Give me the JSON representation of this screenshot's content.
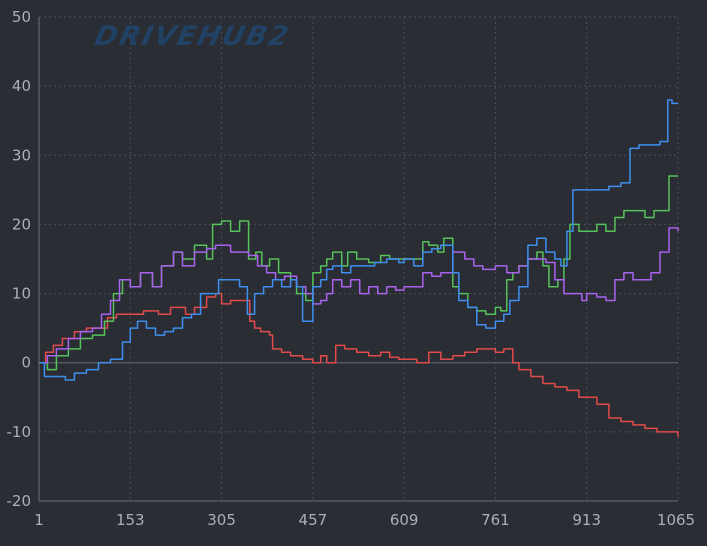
{
  "watermark_text": "DRIVEHUB2",
  "colors": {
    "background": "#2a2d33",
    "grid": "#4a4f57",
    "axis": "#6b717a",
    "zero_line": "#5a5f67",
    "text": "#a9b0bb"
  },
  "chart_data": {
    "type": "line",
    "title": "",
    "xlabel": "",
    "ylabel": "",
    "xlim": [
      1,
      1065
    ],
    "ylim": [
      -20,
      50
    ],
    "x_ticks": [
      1,
      153,
      305,
      457,
      609,
      761,
      913,
      1065
    ],
    "y_ticks": [
      -20,
      -10,
      0,
      10,
      20,
      30,
      40,
      50
    ],
    "grid": true,
    "legend": "none",
    "series": [
      {
        "color": "#e14b4b",
        "points": [
          [
            1,
            0
          ],
          [
            12,
            1.5
          ],
          [
            25,
            2.5
          ],
          [
            40,
            3.5
          ],
          [
            60,
            4.5
          ],
          [
            80,
            5
          ],
          [
            100,
            5
          ],
          [
            115,
            6.5
          ],
          [
            130,
            7
          ],
          [
            153,
            7
          ],
          [
            175,
            7.5
          ],
          [
            200,
            7
          ],
          [
            220,
            8
          ],
          [
            245,
            7
          ],
          [
            260,
            8
          ],
          [
            280,
            9.5
          ],
          [
            295,
            10
          ],
          [
            305,
            8.5
          ],
          [
            320,
            9
          ],
          [
            340,
            9
          ],
          [
            352,
            6
          ],
          [
            360,
            5
          ],
          [
            370,
            4.5
          ],
          [
            385,
            4
          ],
          [
            390,
            2
          ],
          [
            405,
            1.5
          ],
          [
            420,
            1
          ],
          [
            440,
            0.5
          ],
          [
            457,
            0
          ],
          [
            470,
            1
          ],
          [
            480,
            0
          ],
          [
            495,
            2.5
          ],
          [
            510,
            2
          ],
          [
            530,
            1.5
          ],
          [
            550,
            1
          ],
          [
            570,
            1.5
          ],
          [
            585,
            0.8
          ],
          [
            600,
            0.5
          ],
          [
            609,
            0.5
          ],
          [
            630,
            0
          ],
          [
            650,
            1.5
          ],
          [
            670,
            0.5
          ],
          [
            690,
            1
          ],
          [
            710,
            1.5
          ],
          [
            730,
            2
          ],
          [
            745,
            2
          ],
          [
            761,
            1.5
          ],
          [
            775,
            2
          ],
          [
            790,
            0
          ],
          [
            800,
            -1
          ],
          [
            820,
            -2
          ],
          [
            840,
            -3
          ],
          [
            860,
            -3.5
          ],
          [
            880,
            -4
          ],
          [
            900,
            -5
          ],
          [
            913,
            -5
          ],
          [
            930,
            -6
          ],
          [
            950,
            -8
          ],
          [
            970,
            -8.5
          ],
          [
            990,
            -9
          ],
          [
            1010,
            -9.5
          ],
          [
            1030,
            -10
          ],
          [
            1050,
            -10
          ],
          [
            1065,
            -10.7
          ]
        ]
      },
      {
        "color": "#56c25a",
        "points": [
          [
            1,
            0
          ],
          [
            15,
            -1
          ],
          [
            30,
            1
          ],
          [
            50,
            2
          ],
          [
            70,
            3.5
          ],
          [
            90,
            4
          ],
          [
            110,
            6
          ],
          [
            125,
            10
          ],
          [
            140,
            12
          ],
          [
            153,
            11
          ],
          [
            170,
            13
          ],
          [
            190,
            11
          ],
          [
            205,
            14
          ],
          [
            225,
            16
          ],
          [
            240,
            15
          ],
          [
            260,
            17
          ],
          [
            280,
            15
          ],
          [
            290,
            20
          ],
          [
            305,
            20.5
          ],
          [
            320,
            19
          ],
          [
            335,
            20.5
          ],
          [
            350,
            15
          ],
          [
            362,
            16
          ],
          [
            372,
            14
          ],
          [
            385,
            15
          ],
          [
            400,
            13
          ],
          [
            420,
            12
          ],
          [
            430,
            10
          ],
          [
            445,
            9
          ],
          [
            457,
            13
          ],
          [
            470,
            14
          ],
          [
            480,
            15
          ],
          [
            490,
            16
          ],
          [
            505,
            14
          ],
          [
            515,
            16
          ],
          [
            530,
            15
          ],
          [
            550,
            14.5
          ],
          [
            570,
            15.5
          ],
          [
            585,
            15
          ],
          [
            600,
            15
          ],
          [
            609,
            15
          ],
          [
            620,
            15
          ],
          [
            640,
            17.5
          ],
          [
            650,
            17
          ],
          [
            665,
            16
          ],
          [
            675,
            18
          ],
          [
            690,
            11
          ],
          [
            700,
            10
          ],
          [
            715,
            8
          ],
          [
            730,
            7.5
          ],
          [
            745,
            7
          ],
          [
            761,
            8
          ],
          [
            770,
            7.5
          ],
          [
            780,
            12
          ],
          [
            790,
            13
          ],
          [
            800,
            14
          ],
          [
            815,
            15
          ],
          [
            830,
            16
          ],
          [
            840,
            14
          ],
          [
            850,
            11
          ],
          [
            865,
            12
          ],
          [
            875,
            15
          ],
          [
            885,
            20
          ],
          [
            900,
            19
          ],
          [
            913,
            19
          ],
          [
            930,
            20
          ],
          [
            945,
            19
          ],
          [
            960,
            21
          ],
          [
            975,
            22
          ],
          [
            990,
            22
          ],
          [
            1010,
            21
          ],
          [
            1025,
            22
          ],
          [
            1040,
            22
          ],
          [
            1050,
            27
          ],
          [
            1065,
            27
          ]
        ]
      },
      {
        "color": "#a963f0",
        "points": [
          [
            1,
            0
          ],
          [
            15,
            1
          ],
          [
            30,
            2
          ],
          [
            50,
            3.5
          ],
          [
            70,
            4.5
          ],
          [
            90,
            5
          ],
          [
            105,
            7
          ],
          [
            120,
            9
          ],
          [
            135,
            12
          ],
          [
            153,
            11
          ],
          [
            170,
            13
          ],
          [
            190,
            11
          ],
          [
            205,
            14
          ],
          [
            225,
            16
          ],
          [
            240,
            14
          ],
          [
            260,
            16
          ],
          [
            280,
            16.5
          ],
          [
            295,
            17
          ],
          [
            305,
            17
          ],
          [
            320,
            16
          ],
          [
            335,
            16
          ],
          [
            350,
            15.5
          ],
          [
            365,
            14
          ],
          [
            380,
            13
          ],
          [
            395,
            12
          ],
          [
            410,
            12.5
          ],
          [
            430,
            11
          ],
          [
            445,
            10
          ],
          [
            457,
            8.5
          ],
          [
            470,
            9
          ],
          [
            480,
            10
          ],
          [
            490,
            12
          ],
          [
            505,
            11
          ],
          [
            520,
            12
          ],
          [
            535,
            10
          ],
          [
            550,
            11
          ],
          [
            565,
            10
          ],
          [
            580,
            11
          ],
          [
            595,
            10.5
          ],
          [
            609,
            11
          ],
          [
            625,
            11
          ],
          [
            640,
            13
          ],
          [
            655,
            12.5
          ],
          [
            670,
            13
          ],
          [
            690,
            16
          ],
          [
            710,
            15
          ],
          [
            725,
            14
          ],
          [
            740,
            13.5
          ],
          [
            761,
            14
          ],
          [
            780,
            13
          ],
          [
            800,
            14
          ],
          [
            815,
            15
          ],
          [
            830,
            15
          ],
          [
            845,
            14.5
          ],
          [
            860,
            12
          ],
          [
            875,
            10
          ],
          [
            890,
            10
          ],
          [
            905,
            9
          ],
          [
            913,
            10
          ],
          [
            930,
            9.5
          ],
          [
            945,
            9
          ],
          [
            960,
            12
          ],
          [
            975,
            13
          ],
          [
            990,
            12
          ],
          [
            1005,
            12
          ],
          [
            1020,
            13
          ],
          [
            1035,
            16
          ],
          [
            1050,
            19.5
          ],
          [
            1065,
            19
          ]
        ]
      },
      {
        "color": "#3f8ff0",
        "points": [
          [
            1,
            0
          ],
          [
            10,
            -2
          ],
          [
            25,
            -2
          ],
          [
            45,
            -2.5
          ],
          [
            60,
            -1.5
          ],
          [
            80,
            -1
          ],
          [
            100,
            0
          ],
          [
            120,
            0.5
          ],
          [
            140,
            3
          ],
          [
            153,
            5
          ],
          [
            165,
            6
          ],
          [
            180,
            5
          ],
          [
            195,
            4
          ],
          [
            210,
            4.5
          ],
          [
            225,
            5
          ],
          [
            240,
            6.5
          ],
          [
            255,
            7
          ],
          [
            270,
            10
          ],
          [
            285,
            10
          ],
          [
            300,
            12
          ],
          [
            305,
            12
          ],
          [
            320,
            12
          ],
          [
            335,
            11
          ],
          [
            348,
            7
          ],
          [
            360,
            10
          ],
          [
            375,
            11
          ],
          [
            390,
            12
          ],
          [
            405,
            11
          ],
          [
            420,
            12
          ],
          [
            430,
            11
          ],
          [
            440,
            6
          ],
          [
            452,
            6
          ],
          [
            457,
            11
          ],
          [
            470,
            12
          ],
          [
            480,
            13.5
          ],
          [
            490,
            14
          ],
          [
            505,
            13
          ],
          [
            520,
            14
          ],
          [
            540,
            14
          ],
          [
            560,
            14.5
          ],
          [
            580,
            15
          ],
          [
            600,
            14.5
          ],
          [
            609,
            15
          ],
          [
            625,
            14
          ],
          [
            640,
            16
          ],
          [
            655,
            16.5
          ],
          [
            670,
            17
          ],
          [
            690,
            13
          ],
          [
            700,
            9
          ],
          [
            715,
            8
          ],
          [
            730,
            5.5
          ],
          [
            745,
            5
          ],
          [
            761,
            6
          ],
          [
            775,
            7
          ],
          [
            785,
            9
          ],
          [
            800,
            11
          ],
          [
            815,
            17
          ],
          [
            830,
            18
          ],
          [
            845,
            16
          ],
          [
            860,
            15
          ],
          [
            870,
            14
          ],
          [
            880,
            19
          ],
          [
            890,
            25
          ],
          [
            905,
            25
          ],
          [
            913,
            25
          ],
          [
            930,
            25
          ],
          [
            950,
            25.5
          ],
          [
            970,
            26
          ],
          [
            985,
            31
          ],
          [
            1000,
            31.5
          ],
          [
            1020,
            31.5
          ],
          [
            1035,
            32
          ],
          [
            1048,
            38
          ],
          [
            1055,
            37.5
          ],
          [
            1065,
            37.5
          ]
        ]
      }
    ]
  }
}
